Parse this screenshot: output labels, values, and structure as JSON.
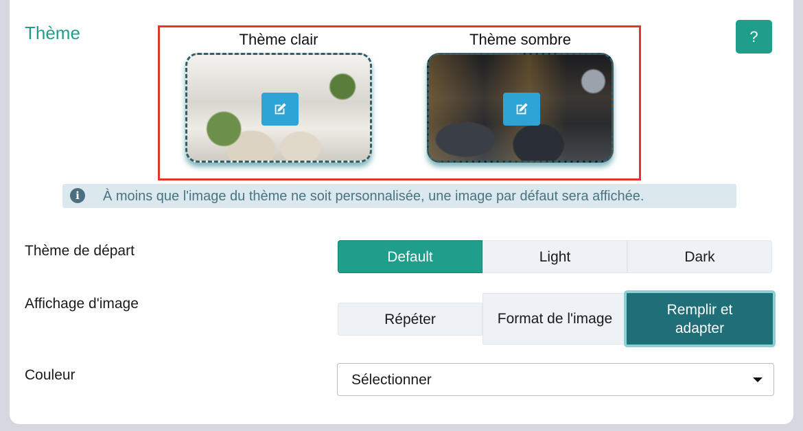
{
  "section": {
    "title": "Thème",
    "help_label": "?"
  },
  "themes": {
    "light": {
      "label": "Thème clair"
    },
    "dark": {
      "label": "Thème sombre"
    }
  },
  "info": {
    "text": "À moins que l'image du thème ne soit personnalisée, une image par défaut sera affichée."
  },
  "start_theme": {
    "label": "Thème de départ",
    "options": [
      "Default",
      "Light",
      "Dark"
    ],
    "selected": "Default"
  },
  "image_display": {
    "label": "Affichage d'image",
    "options": [
      "Répéter",
      "Format de l'image",
      "Remplir et adapter"
    ],
    "selected": "Remplir et adapter"
  },
  "color": {
    "label": "Couleur",
    "selected": "Sélectionner"
  },
  "colors": {
    "primary": "#1f9e8c",
    "selected_teal": "#1e6f78",
    "edit_button": "#2ea3d5",
    "highlight_border": "#e0372b"
  }
}
